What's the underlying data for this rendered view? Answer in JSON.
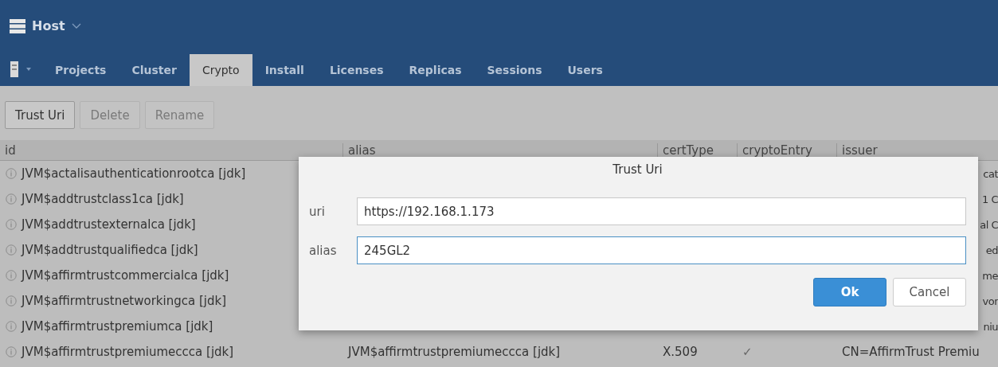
{
  "header": {
    "title": "Host"
  },
  "tabs": [
    {
      "label": "Projects",
      "selected": false
    },
    {
      "label": "Cluster",
      "selected": false
    },
    {
      "label": "Crypto",
      "selected": true
    },
    {
      "label": "Install",
      "selected": false
    },
    {
      "label": "Licenses",
      "selected": false
    },
    {
      "label": "Replicas",
      "selected": false
    },
    {
      "label": "Sessions",
      "selected": false
    },
    {
      "label": "Users",
      "selected": false
    }
  ],
  "toolbar": [
    {
      "label": "Trust Uri",
      "disabled": false
    },
    {
      "label": "Delete",
      "disabled": true
    },
    {
      "label": "Rename",
      "disabled": true
    }
  ],
  "table": {
    "columns": [
      "id",
      "alias",
      "certType",
      "cryptoEntry",
      "issuer"
    ],
    "rows": [
      {
        "id": "JVM$actalisauthenticationrootca [jdk]",
        "issuer": "cat"
      },
      {
        "id": "JVM$addtrustclass1ca [jdk]",
        "issuer": "1 C"
      },
      {
        "id": "JVM$addtrustexternalca [jdk]",
        "issuer": "al C"
      },
      {
        "id": "JVM$addtrustqualifiedca [jdk]",
        "issuer": "ed"
      },
      {
        "id": "JVM$affirmtrustcommercialca [jdk]",
        "issuer": "me"
      },
      {
        "id": "JVM$affirmtrustnetworkingca [jdk]",
        "issuer": "vor"
      },
      {
        "id": "JVM$affirmtrustpremiumca [jdk]",
        "issuer": "niu"
      },
      {
        "id": "JVM$affirmtrustpremiumeccca [jdk]",
        "alias": "JVM$affirmtrustpremiumeccca [jdk]",
        "cert_type": "X.509",
        "crypto_entry": "✓",
        "issuer": "CN=AffirmTrust Premiu"
      }
    ]
  },
  "dialog": {
    "title": "Trust Uri",
    "fields": [
      {
        "label": "uri",
        "value": "https://192.168.1.173",
        "focused": false
      },
      {
        "label": "alias",
        "value": "245GL2",
        "focused": true
      }
    ],
    "buttons": [
      {
        "label": "Ok",
        "kind": "primary"
      },
      {
        "label": "Cancel",
        "kind": "secondary"
      }
    ]
  }
}
